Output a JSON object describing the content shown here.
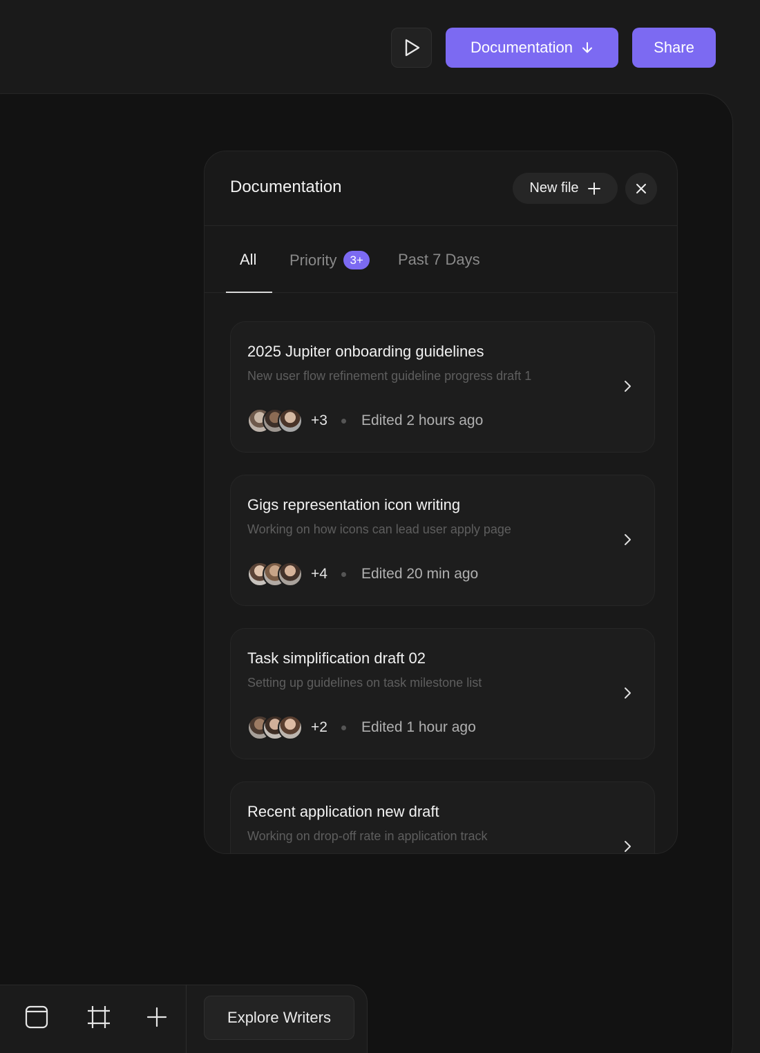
{
  "toolbar": {
    "play_icon": "play-icon",
    "documentation_label": "Documentation",
    "documentation_icon": "arrow-down-icon",
    "share_label": "Share",
    "accent_color": "#7c6af2"
  },
  "panel": {
    "title": "Documentation",
    "new_file_label": "New file",
    "new_file_icon": "plus-icon",
    "close_icon": "close-icon",
    "tabs": [
      {
        "label": "All",
        "active": true
      },
      {
        "label": "Priority",
        "badge": "3+",
        "active": false
      },
      {
        "label": "Past 7 Days",
        "active": false
      }
    ],
    "cards": [
      {
        "title": "2025 Jupiter onboarding guidelines",
        "subtitle": "New user flow refinement guideline progress draft 1",
        "count": "+3",
        "edited": "Edited 2 hours ago"
      },
      {
        "title": "Gigs representation icon writing",
        "subtitle": "Working on how icons can lead user apply page",
        "count": "+4",
        "edited": "Edited 20 min ago"
      },
      {
        "title": "Task simplification draft 02",
        "subtitle": "Setting up guidelines on task milestone list",
        "count": "+2",
        "edited": "Edited 1 hour ago"
      },
      {
        "title": "Recent application new draft",
        "subtitle": "Working on  drop-off rate in application track"
      }
    ]
  },
  "bottom_toolbar": {
    "tools": [
      "frame-icon",
      "crop-icon",
      "plus-icon"
    ],
    "explore_label": "Explore Writers"
  }
}
